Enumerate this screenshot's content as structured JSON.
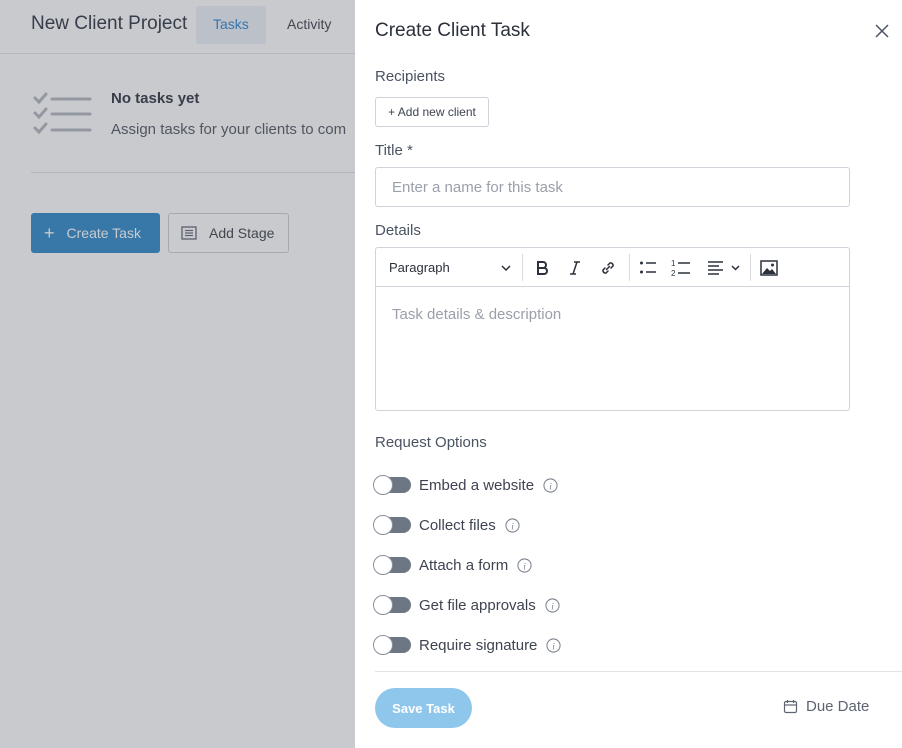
{
  "background": {
    "project_title": "New Client Project",
    "tabs": [
      {
        "label": "Tasks",
        "active": true
      },
      {
        "label": "Activity",
        "active": false
      }
    ],
    "empty_state": {
      "title": "No tasks yet",
      "subtitle": "Assign tasks for your clients to com"
    },
    "create_task_label": "Create Task",
    "add_stage_label": "Add Stage"
  },
  "drawer": {
    "title": "Create Client Task",
    "recipients_label": "Recipients",
    "add_client_label": "+ Add new client",
    "title_label": "Title *",
    "title_placeholder": "Enter a name for this task",
    "details_label": "Details",
    "editor": {
      "block_format": "Paragraph",
      "placeholder": "Task details & description"
    },
    "request_options_label": "Request Options",
    "options": [
      {
        "label": "Embed a website",
        "enabled": false
      },
      {
        "label": "Collect files",
        "enabled": false
      },
      {
        "label": "Attach a form",
        "enabled": false
      },
      {
        "label": "Get file approvals",
        "enabled": false
      },
      {
        "label": "Require signature",
        "enabled": false
      }
    ],
    "save_label": "Save Task",
    "due_date_label": "Due Date"
  },
  "colors": {
    "accent": "#3d92cf",
    "save_disabled": "#8fc7ec",
    "toggle_off": "#6d7683"
  }
}
